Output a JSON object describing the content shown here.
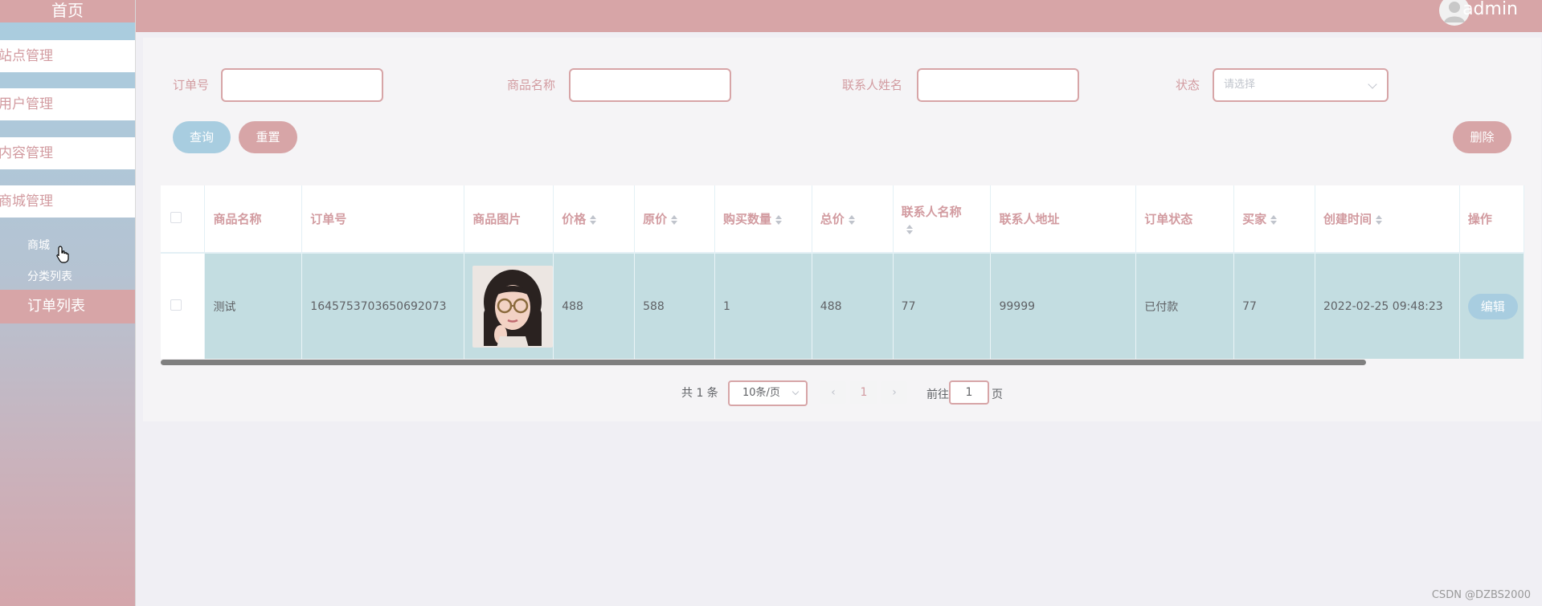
{
  "sidebar": {
    "brand": "首页",
    "menus": [
      "站点管理",
      "用户管理",
      "内容管理",
      "商城管理"
    ],
    "sub_items": [
      "商城",
      "分类列表"
    ],
    "active_item": "订单列表"
  },
  "header": {
    "username": "admin"
  },
  "filters": {
    "order_no_label": "订单号",
    "product_name_label": "商品名称",
    "contact_name_label": "联系人姓名",
    "status_label": "状态",
    "status_placeholder": "请选择"
  },
  "actions": {
    "query": "查询",
    "reset": "重置",
    "delete": "删除"
  },
  "table": {
    "columns": [
      "商品名称",
      "订单号",
      "商品图片",
      "价格",
      "原价",
      "购买数量",
      "总价",
      "联系人名称",
      "联系人地址",
      "订单状态",
      "买家",
      "创建时间",
      "操作"
    ],
    "rows": [
      {
        "product_name": "测试",
        "order_no": "1645753703650692073",
        "price": "488",
        "original_price": "588",
        "quantity": "1",
        "total": "488",
        "contact_name": "77",
        "contact_address": "99999",
        "status": "已付款",
        "buyer": "77",
        "created_at": "2022-02-25 09:48:23",
        "edit_label": "编辑"
      }
    ]
  },
  "pagination": {
    "total_text": "共 1 条",
    "page_size": "10条/页",
    "prev": "‹",
    "current_page": "1",
    "next": "›",
    "goto_label": "前往",
    "goto_value": "1",
    "page_suffix": "页"
  },
  "watermark": "CSDN @DZBS2000",
  "colors": {
    "primary": "#d7a5a7",
    "accent_blue": "#a8cde0",
    "row_bg": "#c3dde1"
  }
}
